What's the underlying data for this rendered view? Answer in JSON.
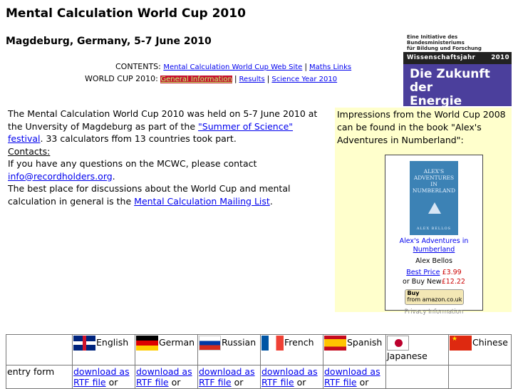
{
  "header": {
    "title": "Mental Calculation World Cup 2010",
    "subtitle": "Magdeburg, Germany, 5-7 June 2010"
  },
  "nav": {
    "contents_label": "CONTENTS:",
    "contents_links": [
      "Mental Calculation World Cup Web Site",
      "Maths Links"
    ],
    "worldcup_label": "WORLD CUP 2010:",
    "worldcup_links": [
      "General Information",
      "Results",
      "Science Year 2010"
    ],
    "separator": "|"
  },
  "banner": {
    "line1": "Eine Initiative des Bundesministeriums",
    "line2": "für Bildung und Forschung",
    "bar_left": "Wissenschaftsjahr",
    "bar_year": "2010",
    "line3": "Die Zukunft der",
    "line4": "Energie"
  },
  "intro": {
    "p1_before": "The Mental Calculation World Cup 2010 was held on 5-7 June 2010 at the Unversity of Magdeburg as part of the ",
    "p1_link": "\"Summer of Science\" festival",
    "p1_after": ". 33 calculators ffom 13 countries took part.",
    "contacts_label": "Contacts:",
    "contact_text": "If you have any questions on the MCWC, please contact",
    "contact_email": "info@recordholders.org",
    "contact_after": ".",
    "discussion_before": "The best place for discussions about the World Cup and mental calculation in general is the ",
    "discussion_link": "Mental Calculation Mailing List",
    "discussion_after": "."
  },
  "book_panel": {
    "text": "Impressions from the World Cup 2008 can be found in the book \"Alex's Adventures in Numberland\":",
    "cover_line1": "ALEX'S",
    "cover_line2": "ADVENTURES",
    "cover_line3": "IN",
    "cover_line4": "NUMBERLAND",
    "cover_author": "ALEX BELLOS",
    "book_title_1": "Alex's Adventures in",
    "book_title_2": "Numberland",
    "author": "Alex Bellos",
    "best_price_label": "Best Price",
    "best_price": "£3.99",
    "buy_new_label": "or Buy New",
    "buy_new_price": "£12.22",
    "buy_button_1": "Buy",
    "buy_button_2": "from amazon.co.uk",
    "privacy": "Privacy Information"
  },
  "languages": {
    "headers": [
      "English",
      "German",
      "Russian",
      "French",
      "Spanish",
      "Japanese",
      "Chinese"
    ],
    "flag_icons": [
      "uk-flag-icon",
      "germany-flag-icon",
      "russia-flag-icon",
      "france-flag-icon",
      "spain-flag-icon",
      "japan-flag-icon",
      "china-flag-icon"
    ],
    "row_label": "entry form",
    "download_line1": "download as",
    "download_line2": "RTF file",
    "download_or": "or"
  }
}
